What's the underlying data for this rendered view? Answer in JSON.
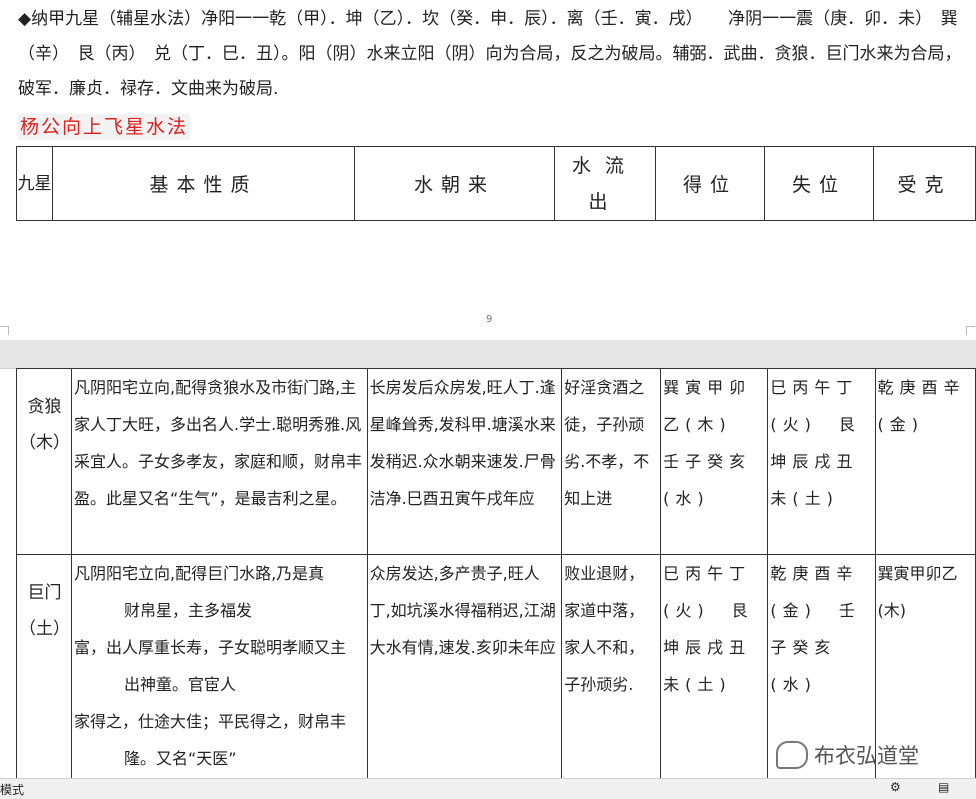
{
  "intro": {
    "line1": "◆纳甲九星（辅星水法）净阳一一乾（甲）．坤（乙）．坎（癸．申．辰）．离（壬．寅．戌）　　净阴一一震（庚．卯．未）　巽",
    "line2": "（辛）　艮（丙）　兑（丁．巳．丑）。阳（阴）水来立阳（阴）向为合局，反之为破局。辅弼．武曲．贪狼．巨门水来为合局，",
    "line3": "破军．廉贞．禄存．文曲来为破局."
  },
  "section_title": "杨公向上飞星水法",
  "table_header": {
    "col1": "九星",
    "col2": "基本性质",
    "col3": "水朝来",
    "col4": "水流出",
    "col5": "得位",
    "col6": "失位",
    "col7": "受克"
  },
  "page_number": "9",
  "rows": [
    {
      "star": "贪狼（木）",
      "nature": "凡阴阳宅立向,配得贪狼水及市街门路,主家人丁大旺，多出名人.学士.聪明秀雅.风采宜人。子女多孝友，家庭和顺，财帛丰盈。此星又名“生气”，是最吉利之星。",
      "incoming": "长房发后众房发,旺人丁.逢星峰耸秀,发科甲.塘溪水来发稍迟.众水朝来速发.尸骨洁净.巳酉丑寅午戌年应",
      "outgoing": "好淫贪酒之徒，子孙顽劣.不孝，不知上进",
      "gain": "巽寅甲卯乙(木)　壬子癸亥(水)",
      "lose": "巳丙午丁(火)　艮坤辰戌丑未(土)",
      "restrain": "乾庚酉辛(金)"
    },
    {
      "star": "巨门（土）",
      "nature_a": "凡阴阳宅立向,配得巨门水路,乃是真",
      "nature_b": "财帛星，主多福发",
      "nature_c": "富，出人厚重长寿，子女聪明孝顺又主",
      "nature_d": "出神童。官宦人",
      "nature_e": "家得之，仕途大佳；平民得之，财帛丰",
      "nature_f": "隆。又名“天医”",
      "incoming": "众房发达,多产贵子,旺人丁,如坑溪水得福稍迟,江湖大水有情,速发.亥卯未年应",
      "outgoing": "败业退财，家道中落，家人不和，子孙顽劣.",
      "gain": "巳丙午丁(火)　艮坤辰戌丑未(土)",
      "lose": "乾庚酉辛(金)　壬子癸亥(水)",
      "restrain": "巽寅甲卯乙(木)"
    }
  ],
  "watermark": "布衣弘道堂",
  "status_left": "模式"
}
